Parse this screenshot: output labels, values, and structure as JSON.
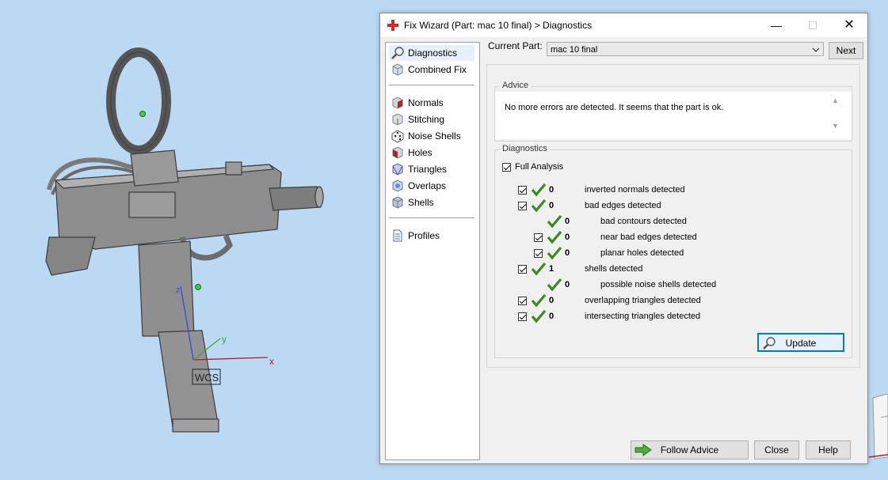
{
  "window": {
    "title": "Fix Wizard (Part: mac 10 final) > Diagnostics",
    "minimize_glyph": "—",
    "maximize_glyph": "☐",
    "close_glyph": "✕"
  },
  "viewport": {
    "wcs_label": "WCS",
    "axis_x": "x",
    "axis_y": "y",
    "axis_z": "z"
  },
  "nav": {
    "items": [
      {
        "label": "Diagnostics",
        "icon": "magnifier-icon",
        "selected": true
      },
      {
        "label": "Combined Fix",
        "icon": "cube-icon"
      },
      {
        "label": "Normals",
        "icon": "normals-cube-icon"
      },
      {
        "label": "Stitching",
        "icon": "stitching-cube-icon"
      },
      {
        "label": "Noise Shells",
        "icon": "dice-icon"
      },
      {
        "label": "Holes",
        "icon": "holes-cube-icon"
      },
      {
        "label": "Triangles",
        "icon": "triangles-cube-icon"
      },
      {
        "label": "Overlaps",
        "icon": "overlaps-cube-icon"
      },
      {
        "label": "Shells",
        "icon": "shells-cube-icon"
      },
      {
        "label": "Profiles",
        "icon": "document-icon"
      }
    ]
  },
  "current_part": {
    "label": "Current Part:",
    "value": "mac 10 final",
    "next_label": "Next"
  },
  "advice": {
    "title": "Advice",
    "text": "No more errors are detected. It seems that the part is ok."
  },
  "diagnostics": {
    "title": "Diagnostics",
    "full_analysis_label": "Full Analysis",
    "rows": [
      {
        "count": "0",
        "text": "inverted normals detected"
      },
      {
        "count": "0",
        "text": "bad edges detected"
      },
      {
        "count": "0",
        "text": "bad contours detected"
      },
      {
        "count": "0",
        "text": "near bad edges detected"
      },
      {
        "count": "0",
        "text": "planar holes detected"
      },
      {
        "count": "1",
        "text": "shells detected"
      },
      {
        "count": "0",
        "text": "possible noise shells detected"
      },
      {
        "count": "0",
        "text": "overlapping triangles detected"
      },
      {
        "count": "0",
        "text": "intersecting triangles detected"
      }
    ],
    "update_label": "Update"
  },
  "footer": {
    "follow_advice_label": "Follow Advice",
    "close_label": "Close",
    "help_label": "Help"
  },
  "colors": {
    "check_green": "#3a8a1e",
    "accent_blue": "#0078d7",
    "background": "#bcd9f3"
  }
}
